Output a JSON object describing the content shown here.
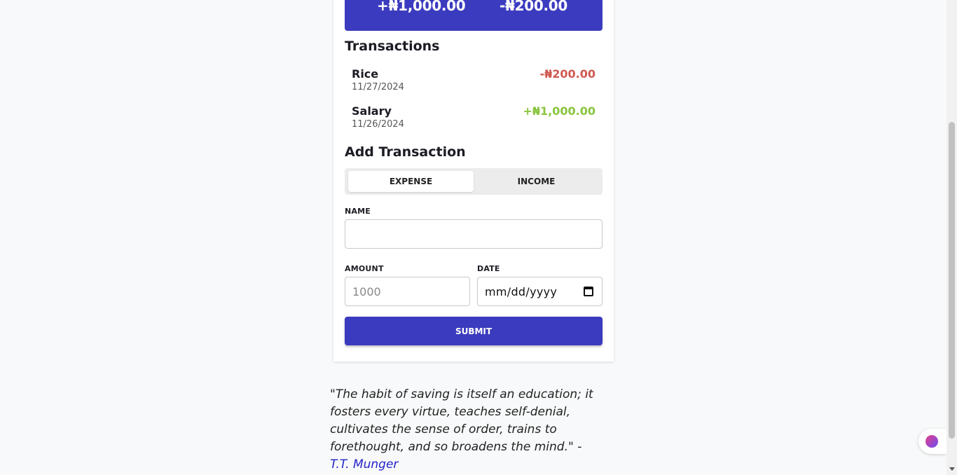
{
  "summary": {
    "income": "+₦1,000.00",
    "expense": "-₦200.00"
  },
  "transactions": {
    "heading": "Transactions",
    "items": [
      {
        "name": "Rice",
        "date": "11/27/2024",
        "amount": "-₦200.00",
        "type": "expense"
      },
      {
        "name": "Salary",
        "date": "11/26/2024",
        "amount": "+₦1,000.00",
        "type": "income"
      }
    ]
  },
  "form": {
    "heading": "Add Transaction",
    "toggle": {
      "expense": "EXPENSE",
      "income": "INCOME",
      "selected": "EXPENSE"
    },
    "name_label": "NAME",
    "name_value": "",
    "amount_label": "AMOUNT",
    "amount_placeholder": "1000",
    "date_label": "DATE",
    "date_placeholder": "mm/dd/yyyy",
    "submit_label": "SUBMIT"
  },
  "quote": {
    "text": "\"The habit of saving is itself an education; it fosters every virtue, teaches self-denial, cultivates the sense of order, trains to forethought, and so broadens the mind.\" - ",
    "author": "T.T. Munger"
  },
  "colors": {
    "primary": "#3b3bbf",
    "expense": "#cf5a52",
    "income": "#8ac43f",
    "author_link": "#2323c8"
  },
  "icons": {
    "date_picker": "calendar-icon",
    "assistant": "brain-icon"
  }
}
